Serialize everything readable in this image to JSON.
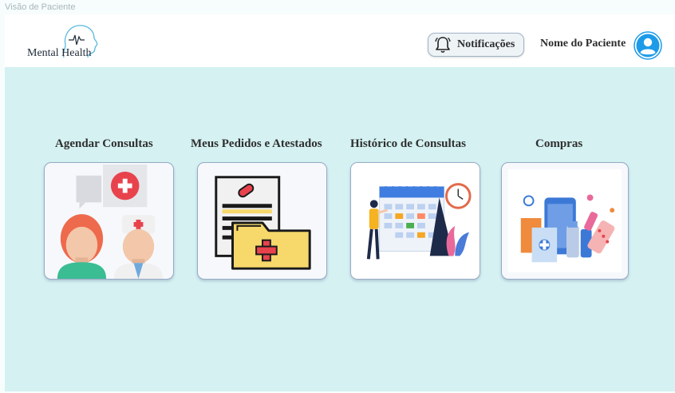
{
  "window": {
    "title": "Visão de Paciente"
  },
  "header": {
    "logo_text": "Mental Health",
    "notifications_label": "Notificações",
    "patient_name": "Nome do Paciente"
  },
  "cards": [
    {
      "title": "Agendar Consultas"
    },
    {
      "title": "Meus Pedidos e Atestados"
    },
    {
      "title": "Histórico de Consultas"
    },
    {
      "title": "Compras"
    }
  ],
  "colors": {
    "main_background": "#d5f1f2",
    "avatar": "#1e9be8",
    "accent_red": "#e8434d"
  }
}
